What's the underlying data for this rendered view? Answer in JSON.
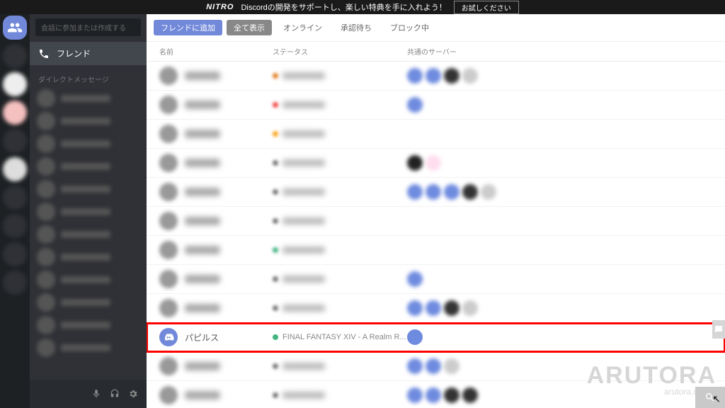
{
  "topbar": {
    "nitro": "NITRO",
    "message": "Discordの開発をサポートし、楽しい特典を手に入れよう！",
    "try": "お試しください"
  },
  "sidebar": {
    "search_placeholder": "会話に参加または作成する",
    "friends_label": "フレンド",
    "dm_header": "ダイレクトメッセージ"
  },
  "tabs": {
    "add": "フレンドに追加",
    "all": "全て表示",
    "online": "オンライン",
    "pending": "承認待ち",
    "blocked": "ブロック中"
  },
  "columns": {
    "name": "名前",
    "status": "ステータス",
    "servers": "共通のサーバー"
  },
  "highlighted": {
    "name": "パピルス",
    "status_text": "FINAL FANTASY XIV - A Realm R...",
    "status_color": "#43b581"
  },
  "rows": [
    {
      "status_color": "#e67e22",
      "servers": [
        "#6f8bdf",
        "#6f8bdf",
        "#333",
        "#ccc"
      ]
    },
    {
      "status_color": "#f04747",
      "servers": [
        "#6f8bdf"
      ]
    },
    {
      "status_color": "#faa61a",
      "servers": []
    },
    {
      "status_color": "#777",
      "servers": [
        "#222",
        "#fde"
      ]
    },
    {
      "status_color": "#777",
      "servers": [
        "#6f8bdf",
        "#6f8bdf",
        "#6f8bdf",
        "#333",
        "#ccc"
      ]
    },
    {
      "status_color": "#777",
      "servers": []
    },
    {
      "status_color": "#43b581",
      "servers": []
    },
    {
      "status_color": "#777",
      "servers": [
        "#6f8bdf"
      ]
    },
    {
      "status_color": "#777",
      "servers": [
        "#6f8bdf",
        "#6f8bdf",
        "#333",
        "#ccc"
      ]
    },
    {
      "highlighted": true,
      "servers": [
        "#6f8bdf"
      ]
    },
    {
      "status_color": "#777",
      "servers": [
        "#6f8bdf",
        "#6f8bdf",
        "#ccc"
      ]
    },
    {
      "status_color": "#777",
      "servers": [
        "#6f8bdf",
        "#6f8bdf",
        "#333",
        "#333"
      ]
    }
  ],
  "watermark": {
    "big": "ARUTORA",
    "small": "arutora.com"
  }
}
